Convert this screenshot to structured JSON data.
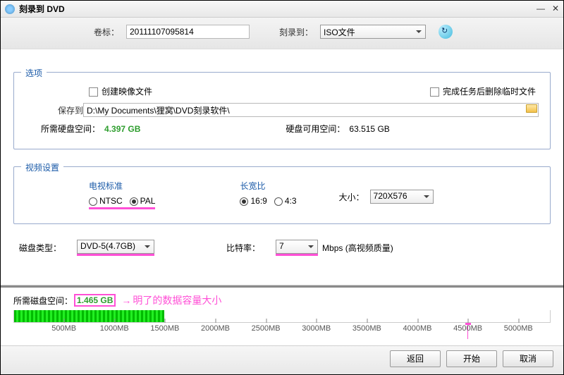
{
  "window": {
    "title": "刻录到 DVD"
  },
  "header": {
    "volume_label": "卷标：",
    "volume_value": "20111107095814",
    "burn_to_label": "刻录到：",
    "burn_to_value": "ISO文件"
  },
  "options": {
    "legend": "选项",
    "create_image": "创建映像文件",
    "delete_temp": "完成任务后删除临时文件",
    "save_to_label": "保存到",
    "save_to_path": "D:\\My Documents\\狸窝\\DVD刻录软件\\",
    "need_space_label": "所需硬盘空间：",
    "need_space_value": "4.397 GB",
    "free_space_label": "硬盘可用空间：",
    "free_space_value": "63.515 GB"
  },
  "video": {
    "legend": "视频设置",
    "tv_label": "电视标准",
    "ntsc": "NTSC",
    "pal": "PAL",
    "aspect_label": "长宽比",
    "r169": "16:9",
    "r43": "4:3",
    "size_label": "大小：",
    "size_value": "720X576"
  },
  "disc": {
    "type_label": "磁盘类型：",
    "type_value": "DVD-5(4.7GB)",
    "bitrate_label": "比特率：",
    "bitrate_value": "7",
    "bitrate_unit": "Mbps",
    "quality": "(高视频质量)"
  },
  "required": {
    "label": "所需磁盘空间：",
    "value": "1.465 GB",
    "annotation": "明了的数据容量大小"
  },
  "ticks": [
    "500MB",
    "1000MB",
    "1500MB",
    "2000MB",
    "2500MB",
    "3000MB",
    "3500MB",
    "4000MB",
    "4500MB",
    "5000MB"
  ],
  "buttons": {
    "back": "返回",
    "start": "开始",
    "cancel": "取消"
  }
}
